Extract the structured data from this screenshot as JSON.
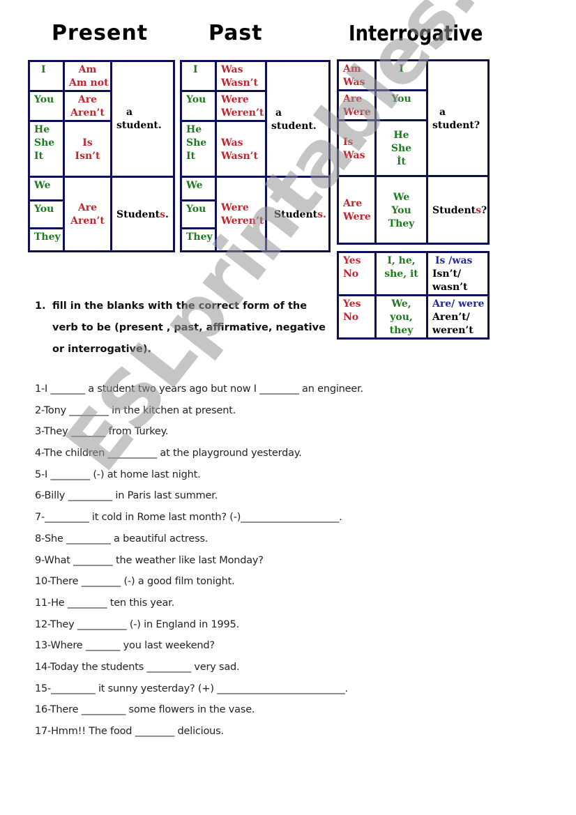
{
  "headings": {
    "present": "Present",
    "past": "Past",
    "interrogative": "Interrogative"
  },
  "present_table": {
    "rows": [
      {
        "subject": [
          "I"
        ],
        "verb": [
          "Am",
          "Am not"
        ]
      },
      {
        "subject": [
          "You"
        ],
        "verb": [
          "Are",
          "Aren’t"
        ]
      },
      {
        "subject": [
          "He",
          "She",
          "It"
        ],
        "verb": [
          "Is",
          "Isn’t"
        ]
      },
      {
        "subject": [
          "We"
        ],
        "verb": [
          "Are",
          "Aren’t"
        ]
      },
      {
        "subject": [
          "You"
        ]
      },
      {
        "subject": [
          "They"
        ]
      }
    ],
    "singular_complement": [
      "a",
      "student."
    ],
    "plural_complement": {
      "stem": "Student",
      "suffix": "s",
      "punct": "."
    }
  },
  "past_table": {
    "rows": [
      {
        "subject": [
          "I"
        ],
        "verb": [
          "Was",
          "Wasn’t"
        ]
      },
      {
        "subject": [
          "You"
        ],
        "verb": [
          "Were",
          "Weren’t"
        ]
      },
      {
        "subject": [
          "He",
          "She",
          "It"
        ],
        "verb": [
          "Was",
          "Wasn’t"
        ]
      },
      {
        "subject": [
          "We"
        ],
        "verb": [
          "Were",
          "Weren’t"
        ]
      },
      {
        "subject": [
          "You"
        ]
      },
      {
        "subject": [
          "They"
        ]
      }
    ],
    "singular_complement": [
      "a",
      "student."
    ],
    "plural_complement": {
      "stem": "Student",
      "suffix": "s",
      "punct": "."
    }
  },
  "interrogative_table": {
    "rows": [
      {
        "verb": [
          "Am",
          "Was"
        ],
        "subject": [
          "I"
        ]
      },
      {
        "verb": [
          "Are",
          "Were"
        ],
        "subject": [
          "You"
        ]
      },
      {
        "verb": [
          "Is",
          "Was"
        ],
        "subject": [
          "He",
          "She",
          "İt"
        ]
      },
      {
        "verb": [
          "Are",
          "Were"
        ],
        "subject": [
          "We",
          "You",
          "They"
        ]
      }
    ],
    "singular_complement": [
      "a",
      "student?"
    ],
    "plural_complement": {
      "stem": "Student",
      "suffix": "s",
      "punct": "?"
    }
  },
  "short_answers_table": {
    "rows": [
      {
        "answer": [
          "Yes",
          "No"
        ],
        "subjects": [
          "I, he,",
          "she, it"
        ],
        "affirmative": "Is /was",
        "negative": [
          "Isn’t/",
          "wasn’t"
        ]
      },
      {
        "answer": [
          "Yes",
          "No"
        ],
        "subjects": [
          "We,",
          "you,",
          "they"
        ],
        "affirmative": "Are/ were",
        "negative": [
          "Aren’t/",
          "weren’t"
        ]
      }
    ]
  },
  "instructions": {
    "number": "1.",
    "lines": [
      "fill in the blanks with the correct form of the",
      "verb to be (present , past, affirmative, negative",
      "or interrogative)."
    ]
  },
  "exercises": [
    "1-I _______ a student two years ago but now I ________ an engineer.",
    "2-Tony ________ in the kitchen at present.",
    "3-They _______ from Turkey.",
    "4-The children __________ at the playground yesterday.",
    "5-I ________ (-) at home last night.",
    "6-Billy _________ in Paris last summer.",
    "7-_________ it cold in Rome last month? (-)____________________.",
    "8-She _________ a beautiful actress.",
    "9-What ________ the weather like last Monday?",
    "10-There ________ (-) a good film tonight.",
    "11-He ________ ten this year.",
    "12-They __________ (-) in England in 1995.",
    "13-Where _______ you last weekend?",
    "14-Today the students _________ very sad.",
    "15-_________ it sunny yesterday? (+) __________________________.",
    "16-There _________ some flowers in the vase.",
    "17-Hmm!! The food ________ delicious."
  ],
  "watermark": "ESLprintables.com",
  "colors": {
    "border": "#0e1057",
    "subject_green": "#1f7a1f",
    "verb_red": "#c4232b",
    "short_answer_blue": "#1c2a9c"
  }
}
